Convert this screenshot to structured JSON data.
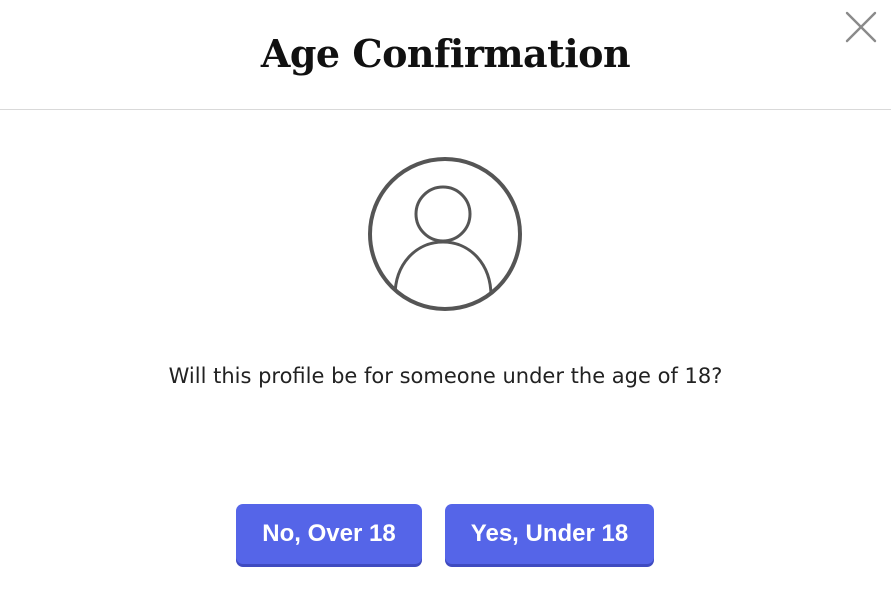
{
  "dialog": {
    "title": "Age Confirmation",
    "close_icon": "close-icon",
    "avatar_icon": "user-avatar-icon",
    "question": "Will this profile be for someone under the age of 18?",
    "buttons": {
      "no_label": "No, Over 18",
      "yes_label": "Yes, Under 18"
    }
  },
  "colors": {
    "button_background": "#5565e8",
    "button_text": "#ffffff",
    "title_text": "#111111",
    "icon_stroke": "#555555",
    "divider": "#d9d9d9"
  }
}
